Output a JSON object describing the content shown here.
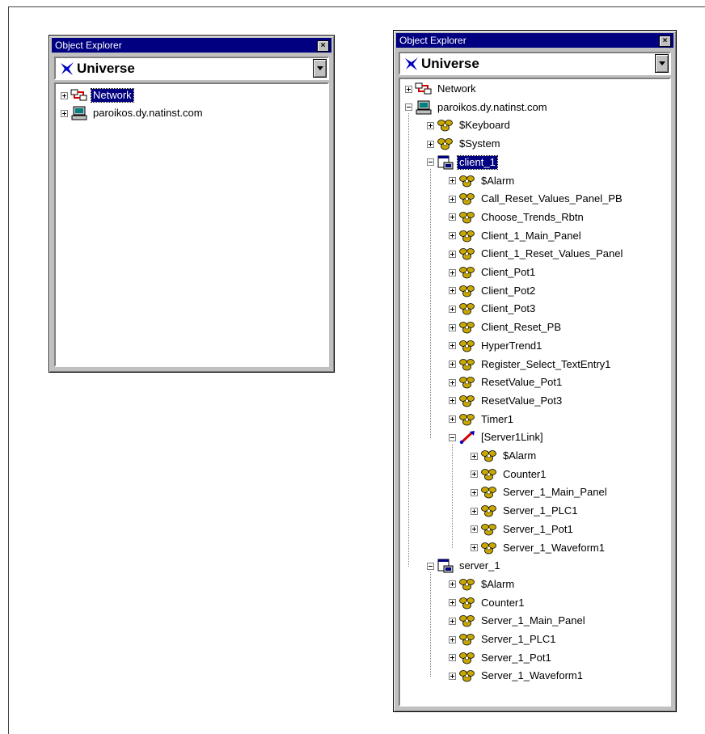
{
  "left_window": {
    "title": "Object Explorer",
    "close": "×",
    "combo": "Universe",
    "tree": [
      {
        "label": "Network",
        "icon": "network-icon",
        "level": 0,
        "expander": "plus",
        "selected": true
      },
      {
        "label": "paroikos.dy.natinst.com",
        "icon": "computer-icon",
        "level": 0,
        "expander": "plus",
        "selected": false
      }
    ]
  },
  "right_window": {
    "title": "Object Explorer",
    "close": "×",
    "combo": "Universe",
    "tree": [
      {
        "label": "Network",
        "icon": "network-icon",
        "level": 0,
        "expander": "plus",
        "selected": false
      },
      {
        "label": "paroikos.dy.natinst.com",
        "icon": "computer-icon",
        "level": 0,
        "expander": "minus",
        "selected": false
      },
      {
        "label": "$Keyboard",
        "icon": "object-icon",
        "level": 1,
        "expander": "plus",
        "selected": false
      },
      {
        "label": "$System",
        "icon": "object-icon",
        "level": 1,
        "expander": "plus",
        "selected": false
      },
      {
        "label": "client_1",
        "icon": "process-icon",
        "level": 1,
        "expander": "minus",
        "selected": true
      },
      {
        "label": "$Alarm",
        "icon": "object-icon",
        "level": 2,
        "expander": "plus",
        "selected": false
      },
      {
        "label": "Call_Reset_Values_Panel_PB",
        "icon": "object-icon",
        "level": 2,
        "expander": "plus",
        "selected": false
      },
      {
        "label": "Choose_Trends_Rbtn",
        "icon": "object-icon",
        "level": 2,
        "expander": "plus",
        "selected": false
      },
      {
        "label": "Client_1_Main_Panel",
        "icon": "object-icon",
        "level": 2,
        "expander": "plus",
        "selected": false
      },
      {
        "label": "Client_1_Reset_Values_Panel",
        "icon": "object-icon",
        "level": 2,
        "expander": "plus",
        "selected": false
      },
      {
        "label": "Client_Pot1",
        "icon": "object-icon",
        "level": 2,
        "expander": "plus",
        "selected": false
      },
      {
        "label": "Client_Pot2",
        "icon": "object-icon",
        "level": 2,
        "expander": "plus",
        "selected": false
      },
      {
        "label": "Client_Pot3",
        "icon": "object-icon",
        "level": 2,
        "expander": "plus",
        "selected": false
      },
      {
        "label": "Client_Reset_PB",
        "icon": "object-icon",
        "level": 2,
        "expander": "plus",
        "selected": false
      },
      {
        "label": "HyperTrend1",
        "icon": "object-icon",
        "level": 2,
        "expander": "plus",
        "selected": false
      },
      {
        "label": "Register_Select_TextEntry1",
        "icon": "object-icon",
        "level": 2,
        "expander": "plus",
        "selected": false
      },
      {
        "label": "ResetValue_Pot1",
        "icon": "object-icon",
        "level": 2,
        "expander": "plus",
        "selected": false
      },
      {
        "label": "ResetValue_Pot3",
        "icon": "object-icon",
        "level": 2,
        "expander": "plus",
        "selected": false
      },
      {
        "label": "Timer1",
        "icon": "object-icon",
        "level": 2,
        "expander": "plus",
        "selected": false
      },
      {
        "label": "[Server1Link]",
        "icon": "link-icon",
        "level": 2,
        "expander": "minus",
        "selected": false
      },
      {
        "label": "$Alarm",
        "icon": "object-icon",
        "level": 3,
        "expander": "plus",
        "selected": false
      },
      {
        "label": "Counter1",
        "icon": "object-icon",
        "level": 3,
        "expander": "plus",
        "selected": false
      },
      {
        "label": "Server_1_Main_Panel",
        "icon": "object-icon",
        "level": 3,
        "expander": "plus",
        "selected": false
      },
      {
        "label": "Server_1_PLC1",
        "icon": "object-icon",
        "level": 3,
        "expander": "plus",
        "selected": false
      },
      {
        "label": "Server_1_Pot1",
        "icon": "object-icon",
        "level": 3,
        "expander": "plus",
        "selected": false
      },
      {
        "label": "Server_1_Waveform1",
        "icon": "object-icon",
        "level": 3,
        "expander": "plus",
        "selected": false
      },
      {
        "label": "server_1",
        "icon": "process-icon",
        "level": 1,
        "expander": "minus",
        "selected": false
      },
      {
        "label": "$Alarm",
        "icon": "object-icon",
        "level": 2,
        "expander": "plus",
        "selected": false
      },
      {
        "label": "Counter1",
        "icon": "object-icon",
        "level": 2,
        "expander": "plus",
        "selected": false
      },
      {
        "label": "Server_1_Main_Panel",
        "icon": "object-icon",
        "level": 2,
        "expander": "plus",
        "selected": false
      },
      {
        "label": "Server_1_PLC1",
        "icon": "object-icon",
        "level": 2,
        "expander": "plus",
        "selected": false
      },
      {
        "label": "Server_1_Pot1",
        "icon": "object-icon",
        "level": 2,
        "expander": "plus",
        "selected": false
      },
      {
        "label": "Server_1_Waveform1",
        "icon": "object-icon",
        "level": 2,
        "expander": "plus",
        "selected": false
      }
    ]
  },
  "colors": {
    "title_bar": "#000080",
    "selection": "#000080",
    "object_icon": "#c8a800",
    "network_red": "#d00000"
  }
}
